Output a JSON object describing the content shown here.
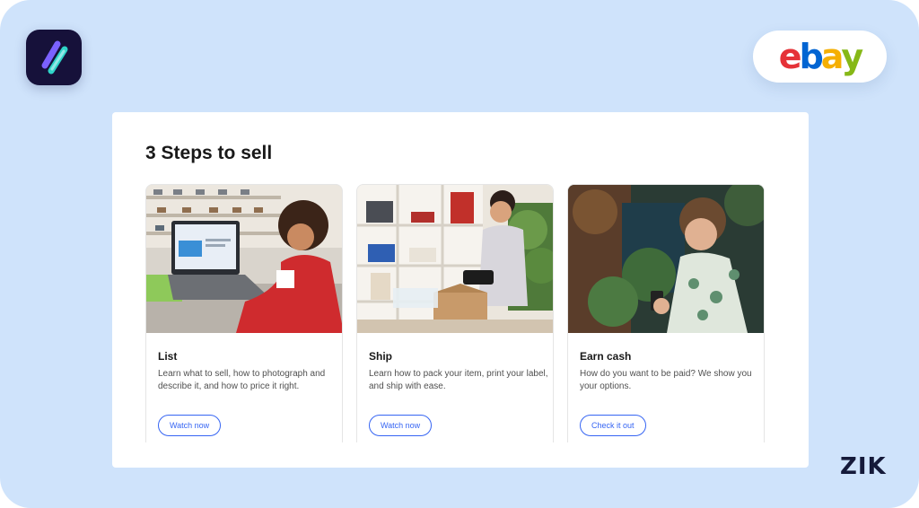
{
  "app_logo": {
    "icon": "double-slash-logo-icon",
    "colors": [
      "#7b61ff",
      "#2fd4c8",
      "#16113a"
    ]
  },
  "brand": {
    "letters": [
      "e",
      "b",
      "a",
      "y"
    ],
    "colors": [
      "#e53238",
      "#0064d2",
      "#f5af02",
      "#86b817"
    ]
  },
  "panel": {
    "title": "3 Steps to sell",
    "cards": [
      {
        "image": "person-listing-on-laptop-photo",
        "title": "List",
        "description": "Learn what to sell, how to photograph and describe it, and how to price it right.",
        "button": "Watch now"
      },
      {
        "image": "person-packing-ebay-box-photo",
        "title": "Ship",
        "description": "Learn how to pack your item, print your label, and ship with ease.",
        "button": "Watch now"
      },
      {
        "image": "person-checking-phone-photo",
        "title": "Earn cash",
        "description": "How do you want to be paid? We show you your options.",
        "button": "Check it out"
      }
    ]
  },
  "watermark": "ZIK",
  "accent_color": "#3665f3"
}
